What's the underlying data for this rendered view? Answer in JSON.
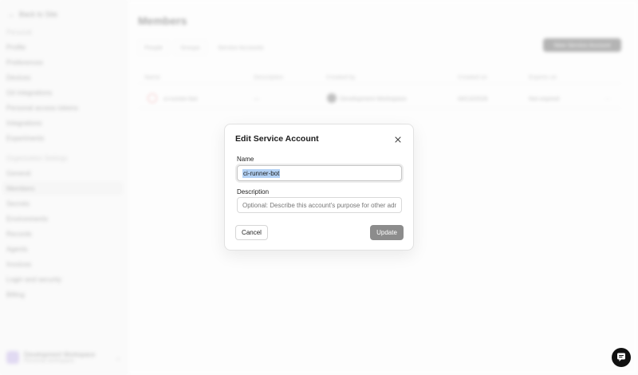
{
  "sidebar": {
    "back_label": "Back to Site",
    "section_1": "Personal",
    "personal_items": [
      "Profile",
      "Preferences",
      "Devices",
      "Git integrations",
      "Personal access tokens",
      "Integrations",
      "Experiments"
    ],
    "section_2": "Organization Settings",
    "org_items": [
      "General",
      "Members",
      "Secrets",
      "Environments",
      "Records",
      "Agents",
      "Invoices",
      "Login and security",
      "Billing"
    ],
    "active_item": "Members",
    "workspace_name": "Development Workspace",
    "workspace_sub": "Personal workspace"
  },
  "main": {
    "title": "Members",
    "filters": [
      "People",
      "Groups",
      "Service Accounts"
    ],
    "new_button": "New Service Account",
    "columns": [
      "Name",
      "Description",
      "Created by",
      "Created on",
      "Expires on"
    ],
    "rows": [
      {
        "name": "ci-runner-bot",
        "description": "—",
        "created_by": "Development Workspace",
        "created_on": "04/13/2026",
        "expires_on": "Not expired",
        "menu": "···"
      }
    ]
  },
  "modal": {
    "title": "Edit Service Account",
    "name_label": "Name",
    "name_value": "ci-runner-bot",
    "description_label": "Description",
    "description_placeholder": "Optional: Describe this account's purpose for other admins.",
    "cancel_label": "Cancel",
    "update_label": "Update"
  },
  "colors": {
    "selection_highlight": "#b4d2f5",
    "update_button_disabled": "#8c8c8c",
    "chat_bubble": "#111111"
  },
  "icons": {
    "close": "close-icon",
    "chat": "chat-icon",
    "back": "arrow-left-icon"
  }
}
